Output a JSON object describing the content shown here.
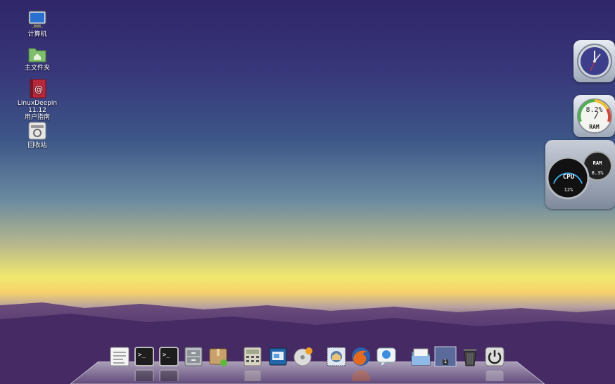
{
  "desktop": {
    "icons": [
      {
        "name": "computer-icon",
        "label": "计算机"
      },
      {
        "name": "home-folder-icon",
        "label": "主文件夹"
      },
      {
        "name": "user-guide-icon",
        "label_line1": "LinuxDeepin 11.12",
        "label_line2": "用户指南"
      },
      {
        "name": "trash-icon",
        "label": "回收站"
      }
    ]
  },
  "widgets": {
    "ram_gauge": {
      "value": "8.2%",
      "label": "RAM"
    },
    "cpu_meter": {
      "cpu_label": "CPU",
      "cpu_value": "12%",
      "ram_label": "RAM",
      "ram_value": "8.3%"
    }
  },
  "dock": {
    "items": [
      "text-editor-icon",
      "terminal-icon",
      "terminal-icon",
      "file-cabinet-icon",
      "package-installer-icon",
      "calculator-icon",
      "presentation-icon",
      "disc-burner-icon",
      "mail-client-icon",
      "firefox-icon",
      "chat-icon",
      "file-manager-icon",
      "workspace-switcher-icon",
      "trash-icon",
      "power-icon"
    ],
    "workspace_number": "1"
  },
  "colors": {
    "accent": "#4a8fe0",
    "sky_top": "#2f2669",
    "horizon": "#efe870"
  }
}
